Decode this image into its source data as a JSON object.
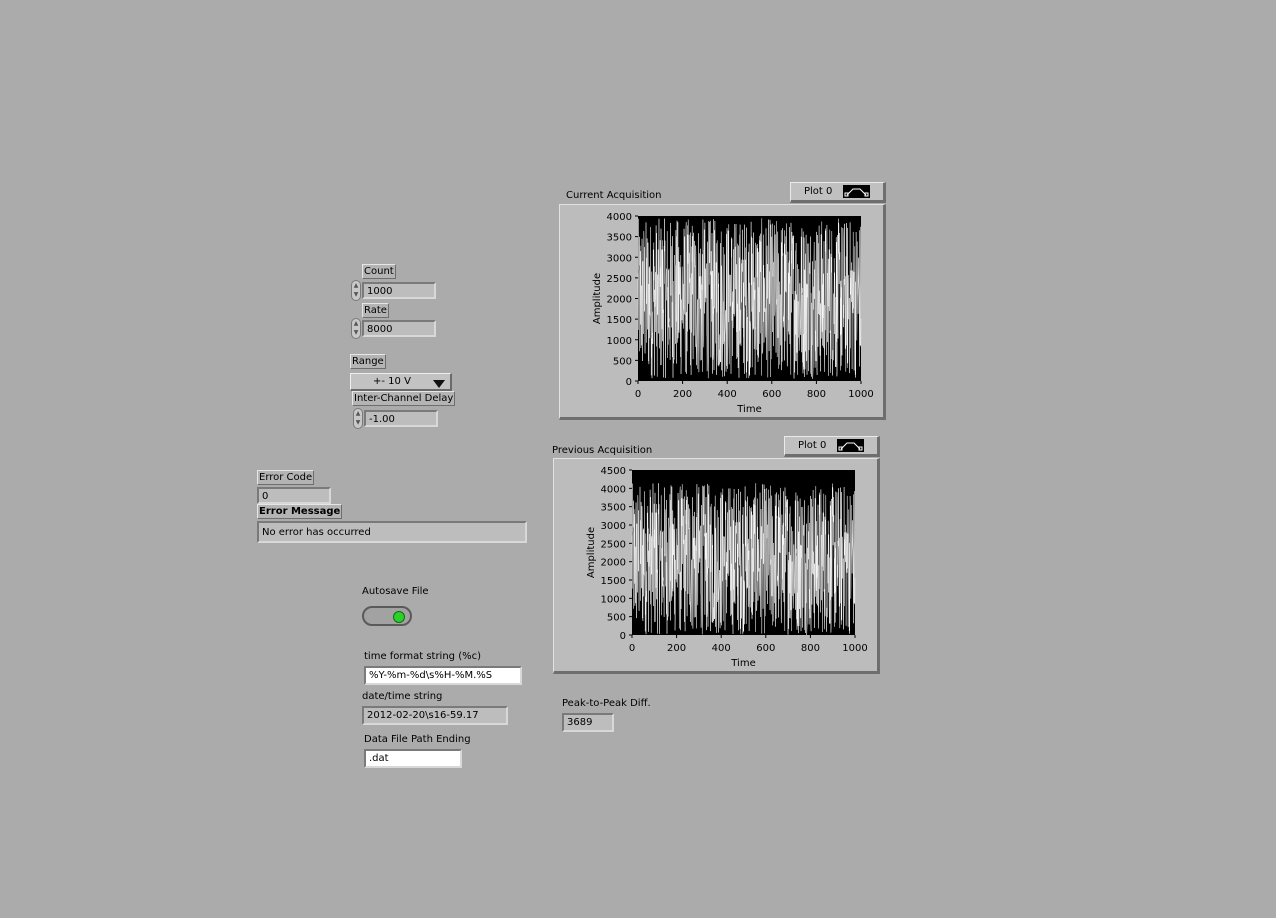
{
  "controls": {
    "count": {
      "label": "Count",
      "value": "1000"
    },
    "rate": {
      "label": "Rate",
      "value": "8000"
    },
    "range": {
      "label": "Range",
      "value": "+- 10 V"
    },
    "delay": {
      "label": "Inter-Channel Delay",
      "value": "-1.00"
    }
  },
  "error": {
    "code_label": "Error Code",
    "code_value": "0",
    "message_label": "Error Message",
    "message_value": "No error has occurred"
  },
  "autosave": {
    "label": "Autosave File",
    "state": true
  },
  "time_format": {
    "label": "time format string (%c)",
    "value": "%Y-%m-%d\\s%H-%M.%S"
  },
  "datetime": {
    "label": "date/time string",
    "value": "2012-02-20\\s16-59.17"
  },
  "data_file": {
    "label": "Data File Path Ending",
    "value": ".dat"
  },
  "peak": {
    "label": "Peak-to-Peak Diff.",
    "value": "3689"
  },
  "colors": {
    "background": "#ababab",
    "plot_bg": "#000000",
    "trace": "#ffffff",
    "led_on": "#2bd12b"
  },
  "chart_data": [
    {
      "type": "line",
      "title": "Current Acquisition",
      "legend": "Plot 0",
      "xlabel": "Time",
      "ylabel": "Amplitude",
      "xlim": [
        0,
        1000
      ],
      "ylim": [
        0,
        4000
      ],
      "xticks": [
        "0",
        "200",
        "400",
        "600",
        "800",
        "1000"
      ],
      "yticks": [
        "0",
        "500",
        "1000",
        "1500",
        "2000",
        "2500",
        "3000",
        "3500",
        "4000"
      ],
      "band": [
        50,
        3950
      ],
      "points": 1000
    },
    {
      "type": "line",
      "title": "Previous Acquisition",
      "legend": "Plot 0",
      "xlabel": "Time",
      "ylabel": "Amplitude",
      "xlim": [
        0,
        1000
      ],
      "ylim": [
        0,
        4500
      ],
      "xticks": [
        "0",
        "200",
        "400",
        "600",
        "800",
        "1000"
      ],
      "yticks": [
        "0",
        "500",
        "1000",
        "1500",
        "2000",
        "2500",
        "3000",
        "3500",
        "4000",
        "4500"
      ],
      "band": [
        0,
        4150
      ],
      "points": 1000
    }
  ]
}
